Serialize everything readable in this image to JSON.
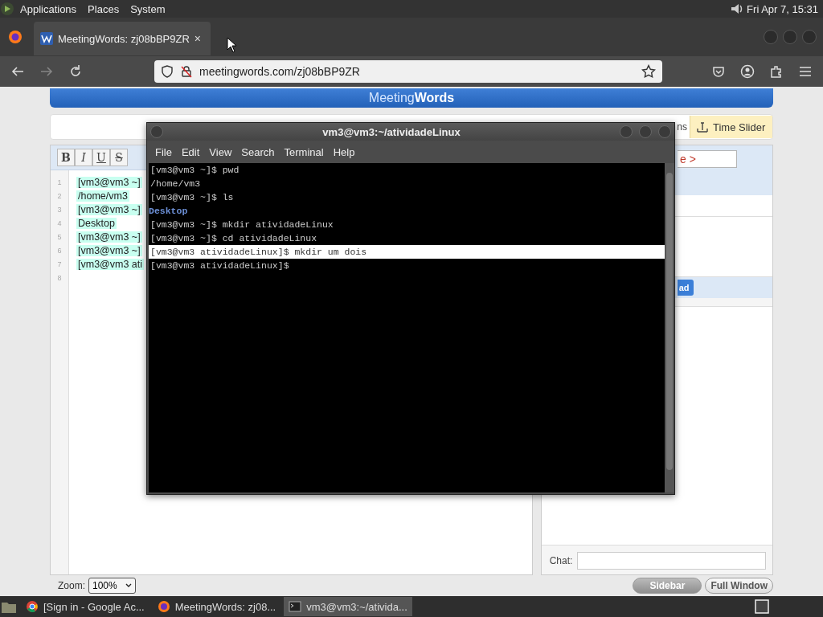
{
  "top_panel": {
    "menus": [
      "Applications",
      "Places",
      "System"
    ],
    "clock": "Fri Apr  7, 15:31"
  },
  "browser": {
    "tabs": [
      {
        "title": "MeetingWords: zj08bBP9ZR",
        "close": "×",
        "selected": true
      }
    ],
    "forward_disabled": true,
    "url": "meetingwords.com/zj08bBP9ZR"
  },
  "page": {
    "logo": "Meeting**Words**",
    "toolbar": {
      "fragment": "ns",
      "time_slider": "Time Slider"
    },
    "format_buttons": [
      {
        "label": "B",
        "kind": "bold"
      },
      {
        "label": "I",
        "kind": "italic"
      },
      {
        "label": "U",
        "kind": "underline"
      },
      {
        "label": "S",
        "kind": "strike"
      }
    ],
    "editor_lines": [
      {
        "number": "1",
        "text": "[vm3@vm3 ~]"
      },
      {
        "number": "2",
        "text": "/home/vm3"
      },
      {
        "number": "3",
        "text": "[vm3@vm3 ~]"
      },
      {
        "number": "4",
        "text": "Desktop"
      },
      {
        "number": "5",
        "text": "[vm3@vm3 ~]"
      },
      {
        "number": "6",
        "text": "[vm3@vm3 ~]"
      },
      {
        "number": "7",
        "text": "[vm3@vm3 ati"
      },
      {
        "number": "8"
      }
    ],
    "sidebar": {
      "name_fragment": "e >",
      "button_fragment": "ad",
      "chat_label": "Chat:"
    },
    "zoom_label": "Zoom:",
    "zoom_value": "100%",
    "buttons": [
      {
        "label": "Sidebar",
        "selected": true
      },
      {
        "label": "Full Window",
        "selected": false
      }
    ]
  },
  "terminal": {
    "title": "vm3@vm3:~/atividadeLinux",
    "menus": [
      "File",
      "Edit",
      "View",
      "Search",
      "Terminal",
      "Help"
    ],
    "lines": [
      {
        "text": "[vm3@vm3 ~]$ pwd",
        "kind": "text",
        "selected": false
      },
      {
        "text": "/home/vm3",
        "kind": "text",
        "selected": false
      },
      {
        "text": "[vm3@vm3 ~]$ ls",
        "kind": "text",
        "selected": false
      },
      {
        "text": "Desktop",
        "kind": "dir",
        "selected": false
      },
      {
        "text": "[vm3@vm3 ~]$ mkdir atividadeLinux",
        "kind": "text",
        "selected": false
      },
      {
        "text": "[vm3@vm3 ~]$ cd atividadeLinux",
        "kind": "text",
        "selected": false
      },
      {
        "text": "[vm3@vm3 atividadeLinux]$ mkdir um dois",
        "kind": "text",
        "selected": true
      },
      {
        "text": "[vm3@vm3 atividadeLinux]$",
        "kind": "text",
        "selected": false
      }
    ]
  },
  "taskbar": {
    "tasks": [
      {
        "label": "[Sign in - Google Ac...",
        "kind": "chrome",
        "selected": false
      },
      {
        "label": "MeetingWords: zj08...",
        "kind": "firefox",
        "selected": false
      },
      {
        "label": "vm3@vm3:~/ativida...",
        "kind": "terminal",
        "selected": true
      }
    ]
  }
}
